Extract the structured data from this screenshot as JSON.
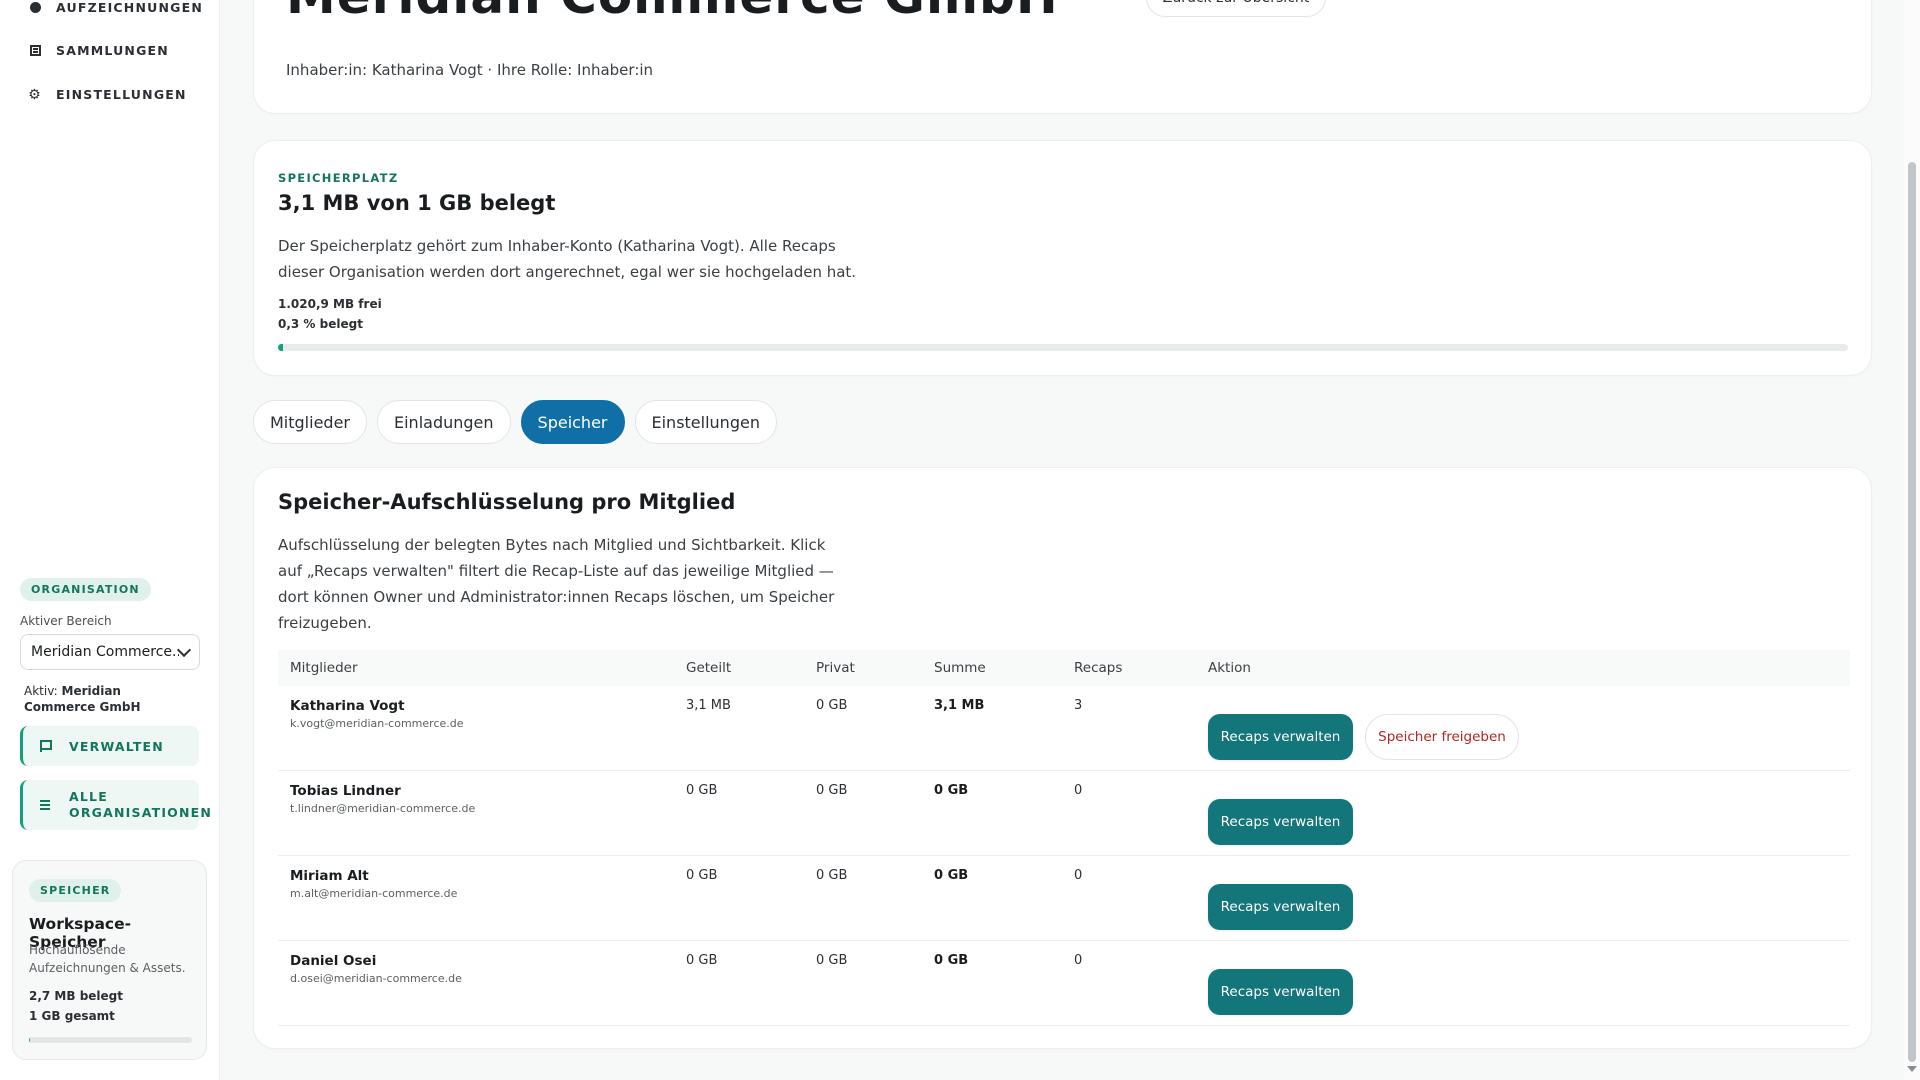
{
  "sidebar": {
    "nav": [
      {
        "label": "AUFZEICHNUNGEN",
        "icon": "record-dot-icon"
      },
      {
        "label": "SAMMLUNGEN",
        "icon": "collection-icon"
      },
      {
        "label": "EINSTELLUNGEN",
        "icon": "gear-icon"
      }
    ],
    "org_pill": "ORGANISATION",
    "aktiv_label": "Aktiver Bereich",
    "select_value": "Meridian Commerce...",
    "aktiv_prefix": "Aktiv:",
    "aktiv_name": "Meridian Commerce GmbH",
    "buttons": [
      {
        "label": "VERWALTEN",
        "icon": "flag-icon"
      },
      {
        "label": "ALLE ORGANISATIONEN",
        "icon": "list-icon"
      }
    ],
    "storage": {
      "pill": "SPEICHER",
      "title": "Workspace-Speicher",
      "desc": "Hochauflösende Aufzeichnungen & Assets.",
      "used": "2,7 MB belegt",
      "total": "1 GB gesamt",
      "fill_fraction": 0.003
    }
  },
  "header": {
    "title": "Meridian Commerce GmbH",
    "back_button": "Zurück zur Übersicht",
    "owner_line": "Inhaber:in: Katharina Vogt · Ihre Rolle: Inhaber:in"
  },
  "space": {
    "eyebrow": "SPEICHERPLATZ",
    "title": "3,1 MB von 1 GB belegt",
    "desc": "Der Speicherplatz gehört zum Inhaber-Konto (Katharina Vogt). Alle Recaps dieser Organisation werden dort angerechnet, egal wer sie hochgeladen hat.",
    "free": "1.020,9 MB frei",
    "pct": "0,3 % belegt",
    "fill_fraction": 0.003
  },
  "tabs": [
    {
      "label": "Mitglieder",
      "active": false
    },
    {
      "label": "Einladungen",
      "active": false
    },
    {
      "label": "Speicher",
      "active": true
    },
    {
      "label": "Einstellungen",
      "active": false
    }
  ],
  "breakdown": {
    "title": "Speicher-Aufschlüsselung pro Mitglied",
    "desc": "Aufschlüsselung der belegten Bytes nach Mitglied und Sichtbarkeit. Klick auf „Recaps verwalten\" filtert die Recap-Liste auf das jeweilige Mitglied — dort können Owner und Administrator:innen Recaps löschen, um Speicher freizugeben.",
    "columns": {
      "member": "Mitglieder",
      "shared": "Geteilt",
      "private": "Privat",
      "sum": "Summe",
      "recaps": "Recaps",
      "action": "Aktion"
    },
    "manage_label": "Recaps verwalten",
    "free_label": "Speicher freigeben",
    "rows": [
      {
        "name": "Katharina Vogt",
        "email": "k.vogt@meridian-commerce.de",
        "shared": "3,1 MB",
        "private": "0 GB",
        "sum": "3,1 MB",
        "recaps": "3"
      },
      {
        "name": "Tobias Lindner",
        "email": "t.lindner@meridian-commerce.de",
        "shared": "0 GB",
        "private": "0 GB",
        "sum": "0 GB",
        "recaps": "0"
      },
      {
        "name": "Miriam Alt",
        "email": "m.alt@meridian-commerce.de",
        "shared": "0 GB",
        "private": "0 GB",
        "sum": "0 GB",
        "recaps": "0"
      },
      {
        "name": "Daniel Osei",
        "email": "d.osei@meridian-commerce.de",
        "shared": "0 GB",
        "private": "0 GB",
        "sum": "0 GB",
        "recaps": "0"
      }
    ]
  }
}
